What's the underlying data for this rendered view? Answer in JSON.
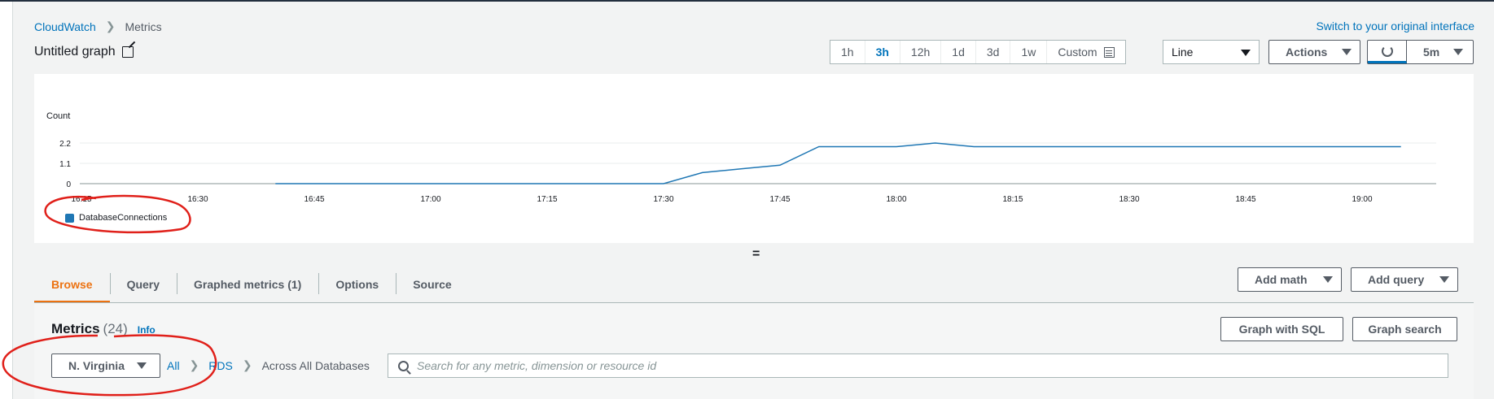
{
  "breadcrumb": {
    "root": "CloudWatch",
    "current": "Metrics"
  },
  "switch_link": "Switch to your original interface",
  "graph_title": "Untitled graph",
  "time_ranges": [
    "1h",
    "3h",
    "12h",
    "1d",
    "3d",
    "1w"
  ],
  "time_range_active": "3h",
  "custom_label": "Custom",
  "chart_type_select": "Line",
  "actions_label": "Actions",
  "refresh_period": "5m",
  "chart_data": {
    "type": "line",
    "ylabel": "Count",
    "y_ticks": [
      "2.2",
      "1.1",
      "0"
    ],
    "x_ticks": [
      "16:15",
      "16:30",
      "16:45",
      "17:00",
      "17:15",
      "17:30",
      "17:45",
      "18:00",
      "18:15",
      "18:30",
      "18:45",
      "19:00"
    ],
    "series": [
      {
        "name": "DatabaseConnections",
        "color": "#1f77b4",
        "x": [
          "16:40",
          "16:45",
          "17:00",
          "17:15",
          "17:30",
          "17:35",
          "17:40",
          "17:45",
          "17:50",
          "17:55",
          "18:00",
          "18:05",
          "18:10",
          "18:15",
          "18:30",
          "18:45",
          "19:00",
          "19:05"
        ],
        "values": [
          0,
          0,
          0,
          0,
          0,
          0.6,
          0.8,
          1.0,
          2.0,
          2.0,
          2.0,
          2.2,
          2.0,
          2.0,
          2.0,
          2.0,
          2.0,
          2.0
        ]
      }
    ]
  },
  "tabs": [
    "Browse",
    "Query",
    "Graphed metrics (1)",
    "Options",
    "Source"
  ],
  "add_math_label": "Add math",
  "add_query_label": "Add query",
  "metrics": {
    "title": "Metrics",
    "count": "(24)",
    "info": "Info"
  },
  "graph_sql_label": "Graph with SQL",
  "graph_search_label": "Graph search",
  "region": "N. Virginia",
  "filter_crumbs": {
    "all": "All",
    "rds": "RDS",
    "scope": "Across All Databases"
  },
  "search_placeholder": "Search for any metric, dimension or resource id"
}
